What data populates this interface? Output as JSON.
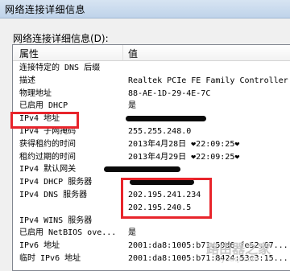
{
  "window": {
    "title": "网络连接详细信息"
  },
  "section_label": "网络连接详细信息(D):",
  "table": {
    "headers": {
      "property": "属性",
      "value": "值"
    },
    "rows": [
      {
        "property": "连接特定的 DNS 后缀",
        "value": ""
      },
      {
        "property": "描述",
        "value": "Realtek PCIe FE Family Controller"
      },
      {
        "property": "物理地址",
        "value": "88-AE-1D-29-4E-7C"
      },
      {
        "property": "已启用 DHCP",
        "value": "是"
      },
      {
        "property": "IPv4 地址",
        "value": ""
      },
      {
        "property": "IPv4 子网掩码",
        "value": "255.255.248.0"
      },
      {
        "property": "获得租约的时间",
        "value": "2013年4月28日 ❤22:09:25❤"
      },
      {
        "property": "租约过期的时间",
        "value": "2013年4月29日 ❤22:09:25❤"
      },
      {
        "property": "IPv4 默认网关",
        "value": ""
      },
      {
        "property": "IPv4 DHCP 服务器",
        "value": ""
      },
      {
        "property": "IPv4 DNS 服务器",
        "value": "202.195.241.234"
      },
      {
        "property": "",
        "value": "202.195.240.5"
      },
      {
        "property": "IPv4 WINS 服务器",
        "value": ""
      },
      {
        "property": "已启用 NetBIOS ove...",
        "value": "是"
      },
      {
        "property": "IPv6 地址",
        "value": "2001:da8:1005:b71:59d6:fe52:67..."
      },
      {
        "property": "临时 IPv6 地址",
        "value": "2001:da8:1005:b71:8424:53c3:15..."
      }
    ]
  },
  "watermark": {
    "main": "路由器之家",
    "sub": "luyouqi.com"
  }
}
